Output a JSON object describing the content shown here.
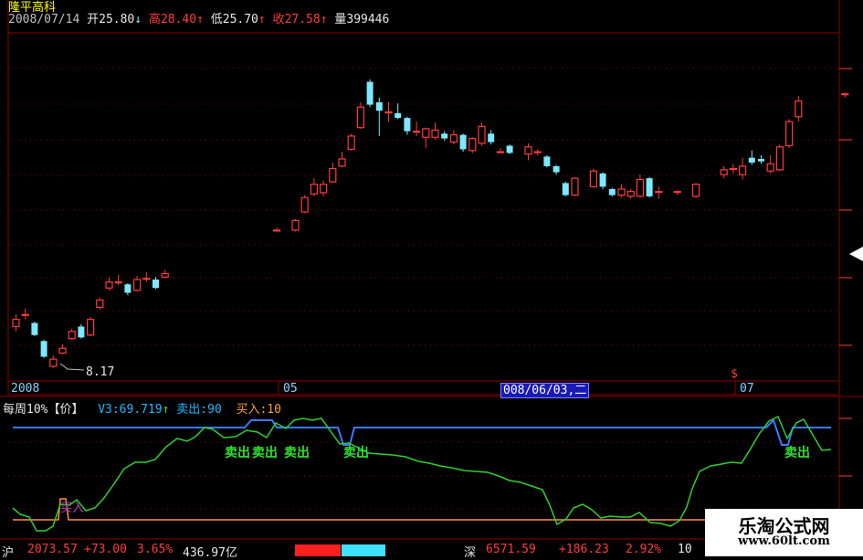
{
  "stock_name": "隆平高科",
  "info_bar": {
    "date": "2008/07/14",
    "open_label": "开",
    "open": "25.80",
    "open_arrow": "↓",
    "high_label": "高",
    "high": "28.40",
    "high_arrow": "↑",
    "low_label": "低",
    "low": "25.70",
    "low_arrow": "↑",
    "close_label": "收",
    "close": "27.58",
    "close_arrow": "↑",
    "volume_label": "量",
    "volume": "399446"
  },
  "low_marker": "8.17",
  "x_axis": {
    "label_2008": "2008",
    "label_05": "05",
    "label_07": "07",
    "cursor_date": "008/06/03,二"
  },
  "indicator": {
    "name": "每周10%",
    "param_open": "【",
    "param": "价",
    "param_close": "】",
    "v3_label": "V3:",
    "v3_value": "69.719",
    "v3_arrow": "↑",
    "sell_label": "卖出:",
    "sell_value": "90",
    "buy_label": "买入:",
    "buy_value": "10",
    "sell_signals": [
      "卖出",
      "卖出",
      "卖出",
      "卖出",
      "卖出"
    ],
    "buy_signal": "买入"
  },
  "bottom_bar": {
    "sh_label": "沪",
    "sh_index": "2073.57",
    "sh_change": "+73.00",
    "sh_pct": "3.65%",
    "sh_amount": "436.97亿",
    "sz_label": "深",
    "sz_index": "6571.59",
    "sz_change": "+186.23",
    "sz_pct": "2.92%",
    "sz_tail": "10"
  },
  "watermark": {
    "title": "乐淘公式网",
    "url": "www.60lt.com"
  },
  "colors": {
    "up": "#ff3b3b",
    "down": "#7ee8ff",
    "grid": "#8b0000",
    "signal_line": "#30d030",
    "sell_level": "#3c78ff",
    "buy_level": "#ff9040"
  },
  "candles": [
    {
      "o": 11.6,
      "c": 12.2,
      "h": 12.6,
      "l": 11.2
    },
    {
      "o": 12.6,
      "c": 12.6,
      "h": 13.1,
      "l": 12.2
    },
    {
      "o": 11.9,
      "c": 10.9,
      "h": 12.0,
      "l": 10.8
    },
    {
      "o": 10.4,
      "c": 9.1,
      "h": 10.5,
      "l": 9.0
    },
    {
      "o": 8.3,
      "c": 8.9,
      "h": 9.2,
      "l": 8.17
    },
    {
      "o": 9.4,
      "c": 9.8,
      "h": 10.1,
      "l": 9.3
    },
    {
      "o": 10.6,
      "c": 11.2,
      "h": 11.4,
      "l": 10.5
    },
    {
      "o": 11.6,
      "c": 10.7,
      "h": 11.8,
      "l": 10.6
    },
    {
      "o": 10.9,
      "c": 12.2,
      "h": 12.4,
      "l": 10.8
    },
    {
      "o": 13.2,
      "c": 13.8,
      "h": 14.0,
      "l": 13.0
    },
    {
      "o": 14.8,
      "c": 15.3,
      "h": 15.7,
      "l": 14.6
    },
    {
      "o": 15.3,
      "c": 15.3,
      "h": 15.9,
      "l": 15.0
    },
    {
      "o": 15.1,
      "c": 14.4,
      "h": 15.2,
      "l": 14.2
    },
    {
      "o": 14.6,
      "c": 15.5,
      "h": 15.8,
      "l": 14.5
    },
    {
      "o": 15.6,
      "c": 15.6,
      "h": 16.1,
      "l": 15.3
    },
    {
      "o": 15.5,
      "c": 14.8,
      "h": 15.7,
      "l": 14.7
    },
    {
      "o": 15.7,
      "c": 16.0,
      "h": 16.3,
      "l": 15.6
    },
    {
      "o": null,
      "c": null,
      "h": null,
      "l": null
    },
    {
      "o": null,
      "c": null,
      "h": null,
      "l": null
    },
    {
      "o": null,
      "c": null,
      "h": null,
      "l": null
    },
    {
      "o": null,
      "c": null,
      "h": null,
      "l": null
    },
    {
      "o": null,
      "c": null,
      "h": null,
      "l": null
    },
    {
      "o": null,
      "c": null,
      "h": null,
      "l": null
    },
    {
      "o": null,
      "c": null,
      "h": null,
      "l": null
    },
    {
      "o": null,
      "c": null,
      "h": null,
      "l": null
    },
    {
      "o": null,
      "c": null,
      "h": null,
      "l": null
    },
    {
      "o": null,
      "c": null,
      "h": null,
      "l": null
    },
    {
      "o": null,
      "c": null,
      "h": null,
      "l": null
    },
    {
      "o": 19.6,
      "c": 19.6,
      "h": 19.8,
      "l": 19.5
    },
    {
      "o": null,
      "c": null,
      "h": null,
      "l": null
    },
    {
      "o": 19.6,
      "c": 20.4,
      "h": 20.5,
      "l": 19.5
    },
    {
      "o": 21.1,
      "c": 22.3,
      "h": 22.5,
      "l": 21.0
    },
    {
      "o": 22.6,
      "c": 23.4,
      "h": 23.9,
      "l": 22.4
    },
    {
      "o": 22.7,
      "c": 23.4,
      "h": 23.7,
      "l": 22.4
    },
    {
      "o": 23.6,
      "c": 24.7,
      "h": 25.2,
      "l": 23.5
    },
    {
      "o": 24.9,
      "c": 25.5,
      "h": 26.1,
      "l": 24.8
    },
    {
      "o": 26.3,
      "c": 27.4,
      "h": 27.6,
      "l": 26.2
    },
    {
      "o": 28.1,
      "c": 29.8,
      "h": 30.2,
      "l": 28.0
    },
    {
      "o": 31.9,
      "c": 30.0,
      "h": 32.1,
      "l": 29.8
    },
    {
      "o": 30.2,
      "c": 29.5,
      "h": 30.6,
      "l": 27.4
    },
    {
      "o": 29.4,
      "c": 29.4,
      "h": 30.2,
      "l": 28.6
    },
    {
      "o": 29.3,
      "c": 28.9,
      "h": 30.1,
      "l": 28.8
    },
    {
      "o": 28.9,
      "c": 27.8,
      "h": 29.0,
      "l": 27.5
    },
    {
      "o": 27.8,
      "c": 27.8,
      "h": 28.6,
      "l": 27.4
    },
    {
      "o": 27.3,
      "c": 28.0,
      "h": 28.1,
      "l": 26.4
    },
    {
      "o": 27.3,
      "c": 27.9,
      "h": 28.5,
      "l": 27.1
    },
    {
      "o": 27.6,
      "c": 27.2,
      "h": 27.8,
      "l": 27.0
    },
    {
      "o": 26.9,
      "c": 27.5,
      "h": 27.9,
      "l": 26.7
    },
    {
      "o": 27.5,
      "c": 26.3,
      "h": 27.6,
      "l": 26.1
    },
    {
      "o": 26.2,
      "c": 27.2,
      "h": 27.3,
      "l": 26.0
    },
    {
      "o": 26.8,
      "c": 28.2,
      "h": 28.5,
      "l": 26.6
    },
    {
      "o": 27.6,
      "c": 26.9,
      "h": 27.9,
      "l": 26.7
    },
    {
      "o": 26.1,
      "c": 26.1,
      "h": 26.4,
      "l": 26.0
    },
    {
      "o": 26.6,
      "c": 26.0,
      "h": 26.7,
      "l": 25.9
    },
    {
      "o": null,
      "c": null,
      "h": null,
      "l": null
    },
    {
      "o": 25.9,
      "c": 26.5,
      "h": 26.8,
      "l": 25.4
    },
    {
      "o": 26.1,
      "c": 26.1,
      "h": 26.3,
      "l": 25.8
    },
    {
      "o": 25.7,
      "c": 24.9,
      "h": 25.8,
      "l": 24.8
    },
    {
      "o": 24.9,
      "c": 24.4,
      "h": 25.0,
      "l": 24.2
    },
    {
      "o": 23.5,
      "c": 22.5,
      "h": 23.6,
      "l": 22.4
    },
    {
      "o": 22.5,
      "c": 23.9,
      "h": 24.0,
      "l": 22.4
    },
    {
      "o": null,
      "c": null,
      "h": null,
      "l": null
    },
    {
      "o": 23.2,
      "c": 24.5,
      "h": 24.7,
      "l": 23.1
    },
    {
      "o": 24.3,
      "c": 23.2,
      "h": 24.4,
      "l": 23.0
    },
    {
      "o": 23.0,
      "c": 22.5,
      "h": 23.1,
      "l": 22.4
    },
    {
      "o": 22.5,
      "c": 23.0,
      "h": 23.4,
      "l": 22.3
    },
    {
      "o": 22.4,
      "c": 22.8,
      "h": 23.0,
      "l": 22.2
    },
    {
      "o": 22.4,
      "c": 23.8,
      "h": 24.2,
      "l": 22.3
    },
    {
      "o": 23.9,
      "c": 22.4,
      "h": 24.0,
      "l": 22.3
    },
    {
      "o": 22.8,
      "c": 22.8,
      "h": 23.2,
      "l": 22.2
    },
    {
      "o": null,
      "c": null,
      "h": null,
      "l": null
    },
    {
      "o": 22.8,
      "c": 22.8,
      "h": 22.9,
      "l": 22.5
    },
    {
      "o": null,
      "c": null,
      "h": null,
      "l": null
    },
    {
      "o": 22.4,
      "c": 23.4,
      "h": 23.5,
      "l": 22.3
    },
    {
      "o": null,
      "c": null,
      "h": null,
      "l": null
    },
    {
      "o": null,
      "c": null,
      "h": null,
      "l": null
    },
    {
      "o": 24.2,
      "c": 24.6,
      "h": 24.9,
      "l": 23.9
    },
    {
      "o": 24.7,
      "c": 24.7,
      "h": 25.1,
      "l": 24.3
    },
    {
      "o": 24.2,
      "c": 24.9,
      "h": 25.6,
      "l": 23.8
    },
    {
      "o": 25.6,
      "c": 25.2,
      "h": 26.2,
      "l": 25.0
    },
    {
      "o": 25.5,
      "c": 25.3,
      "h": 25.8,
      "l": 25.1
    },
    {
      "o": 24.5,
      "c": 25.1,
      "h": 25.8,
      "l": 24.3
    },
    {
      "o": 24.6,
      "c": 26.5,
      "h": 26.7,
      "l": 24.5
    },
    {
      "o": 26.6,
      "c": 28.6,
      "h": 28.8,
      "l": 26.4
    },
    {
      "o": 29.0,
      "c": 30.3,
      "h": 30.7,
      "l": 28.6
    },
    {
      "o": null,
      "c": null,
      "h": null,
      "l": null
    },
    {
      "o": null,
      "c": null,
      "h": null,
      "l": null
    },
    {
      "o": null,
      "c": null,
      "h": null,
      "l": null
    },
    {
      "o": null,
      "c": null,
      "h": null,
      "l": null
    },
    {
      "o": 30.9,
      "c": 30.9,
      "h": 31.0,
      "l": 30.6
    }
  ]
}
